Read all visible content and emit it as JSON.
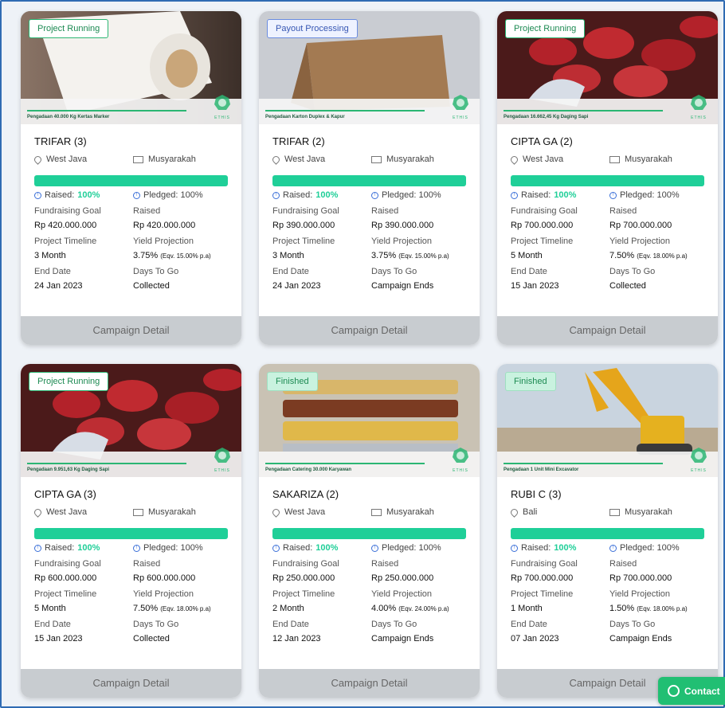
{
  "cards": [
    {
      "status": "Project Running",
      "status_type": "running",
      "image_caption": "Pengadaan 40.000 Kg Kertas Marker",
      "image_scene": "paper-roll",
      "title": "TRIFAR (3)",
      "location": "West Java",
      "akad": "Musyarakah",
      "raised_label": "Raised:",
      "raised_pct": "100%",
      "pledged": "Pledged: 100%",
      "goal_label": "Fundraising Goal",
      "goal": "Rp 420.000.000",
      "raised2_label": "Raised",
      "raised_amount": "Rp 420.000.000",
      "timeline_label": "Project Timeline",
      "timeline": "3 Month",
      "yield_label": "Yield Projection",
      "yield": "3.75%",
      "yield_eq": "(Eqv. 15.00% p.a)",
      "end_label": "End Date",
      "end_date": "24 Jan 2023",
      "days_label": "Days To Go",
      "days": "Collected",
      "button": "Campaign Detail"
    },
    {
      "status": "Payout Processing",
      "status_type": "payout",
      "image_caption": "Pengadaan Karton Duplex & Kapur",
      "image_scene": "cardboard",
      "title": "TRIFAR (2)",
      "location": "West Java",
      "akad": "Musyarakah",
      "raised_label": "Raised:",
      "raised_pct": "100%",
      "pledged": "Pledged: 100%",
      "goal_label": "Fundraising Goal",
      "goal": "Rp 390.000.000",
      "raised2_label": "Raised",
      "raised_amount": "Rp 390.000.000",
      "timeline_label": "Project Timeline",
      "timeline": "3 Month",
      "yield_label": "Yield Projection",
      "yield": "3.75%",
      "yield_eq": "(Eqv. 15.00% p.a)",
      "end_label": "End Date",
      "end_date": "24 Jan 2023",
      "days_label": "Days To Go",
      "days": "Campaign Ends",
      "button": "Campaign Detail"
    },
    {
      "status": "Project Running",
      "status_type": "running",
      "image_caption": "Pengadaan 16.662,45 Kg Daging Sapi",
      "image_scene": "meat",
      "title": "CIPTA GA (2)",
      "location": "West Java",
      "akad": "Musyarakah",
      "raised_label": "Raised:",
      "raised_pct": "100%",
      "pledged": "Pledged: 100%",
      "goal_label": "Fundraising Goal",
      "goal": "Rp 700.000.000",
      "raised2_label": "Raised",
      "raised_amount": "Rp 700.000.000",
      "timeline_label": "Project Timeline",
      "timeline": "5 Month",
      "yield_label": "Yield Projection",
      "yield": "7.50%",
      "yield_eq": "(Eqv. 18.00% p.a)",
      "end_label": "End Date",
      "end_date": "15 Jan 2023",
      "days_label": "Days To Go",
      "days": "Collected",
      "button": "Campaign Detail"
    },
    {
      "status": "Project Running",
      "status_type": "running",
      "image_caption": "Pengadaan 9.951,63 Kg Daging Sapi",
      "image_scene": "meat",
      "title": "CIPTA GA (3)",
      "location": "West Java",
      "akad": "Musyarakah",
      "raised_label": "Raised:",
      "raised_pct": "100%",
      "pledged": "Pledged: 100%",
      "goal_label": "Fundraising Goal",
      "goal": "Rp 600.000.000",
      "raised2_label": "Raised",
      "raised_amount": "Rp 600.000.000",
      "timeline_label": "Project Timeline",
      "timeline": "5 Month",
      "yield_label": "Yield Projection",
      "yield": "7.50%",
      "yield_eq": "(Eqv. 18.00% p.a)",
      "end_label": "End Date",
      "end_date": "15 Jan 2023",
      "days_label": "Days To Go",
      "days": "Collected",
      "button": "Campaign Detail"
    },
    {
      "status": "Finished",
      "status_type": "finished",
      "image_caption": "Pengadaan Catering 30.000 Karyawan",
      "image_scene": "catering",
      "title": "SAKARIZA (2)",
      "location": "West Java",
      "akad": "Musyarakah",
      "raised_label": "Raised:",
      "raised_pct": "100%",
      "pledged": "Pledged: 100%",
      "goal_label": "Fundraising Goal",
      "goal": "Rp 250.000.000",
      "raised2_label": "Raised",
      "raised_amount": "Rp 250.000.000",
      "timeline_label": "Project Timeline",
      "timeline": "2 Month",
      "yield_label": "Yield Projection",
      "yield": "4.00%",
      "yield_eq": "(Eqv. 24.00% p.a)",
      "end_label": "End Date",
      "end_date": "12 Jan 2023",
      "days_label": "Days To Go",
      "days": "Campaign Ends",
      "button": "Campaign Detail"
    },
    {
      "status": "Finished",
      "status_type": "finished",
      "image_caption": "Pengadaan 1 Unit Mini Excavator",
      "image_scene": "excavator",
      "title": "RUBI C (3)",
      "location": "Bali",
      "akad": "Musyarakah",
      "raised_label": "Raised:",
      "raised_pct": "100%",
      "pledged": "Pledged: 100%",
      "goal_label": "Fundraising Goal",
      "goal": "Rp 700.000.000",
      "raised2_label": "Raised",
      "raised_amount": "Rp 700.000.000",
      "timeline_label": "Project Timeline",
      "timeline": "1 Month",
      "yield_label": "Yield Projection",
      "yield": "1.50%",
      "yield_eq": "(Eqv. 18.00% p.a)",
      "end_label": "End Date",
      "end_date": "07 Jan 2023",
      "days_label": "Days To Go",
      "days": "Campaign Ends",
      "button": "Campaign Detail"
    }
  ],
  "brand_watermark": "ETHIS",
  "contact_button": "Contact",
  "colors": {
    "accent_green": "#1fcf98",
    "brand_green": "#2bb673",
    "footer_gray": "#c8ccd0"
  }
}
